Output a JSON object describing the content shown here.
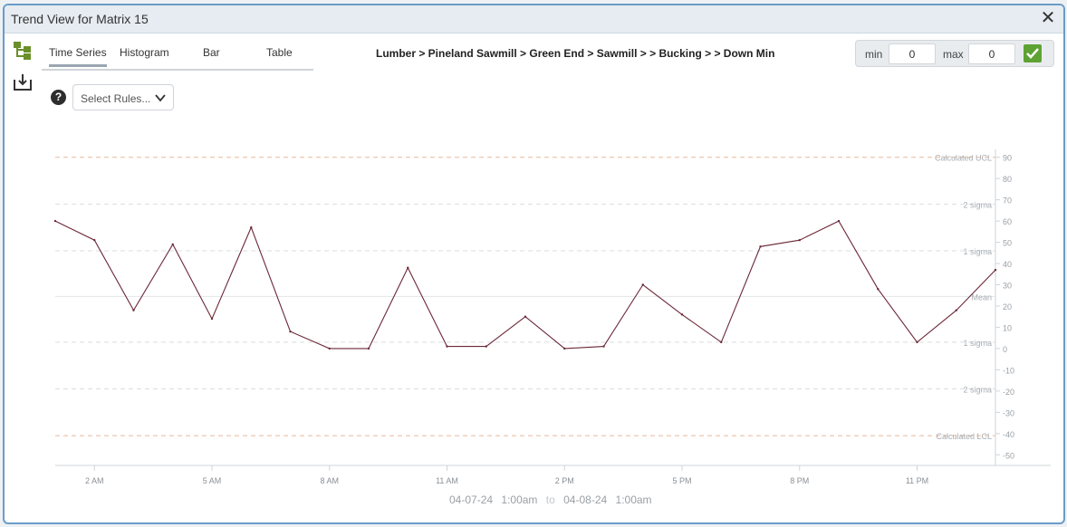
{
  "window": {
    "title": "Trend View for Matrix 15"
  },
  "tabs": [
    {
      "label": "Time Series",
      "active": true
    },
    {
      "label": "Histogram",
      "active": false
    },
    {
      "label": "Bar",
      "active": false
    },
    {
      "label": "Table",
      "active": false
    }
  ],
  "breadcrumb": "Lumber > Pineland Sawmill > Green End > Sawmill > > Bucking > > Down Min",
  "range": {
    "min_label": "min",
    "min_value": "0",
    "max_label": "max",
    "max_value": "0"
  },
  "rules": {
    "placeholder": "Select Rules..."
  },
  "help_label": "?",
  "date_range": {
    "start_date": "04-07-24",
    "start_time": "1:00am",
    "sep": "to",
    "end_date": "04-08-24",
    "end_time": "1:00am"
  },
  "icons": {
    "tree": "tree-structure-icon",
    "export": "download-icon",
    "apply": "check-icon",
    "close": "close-icon"
  },
  "colors": {
    "line": "#6b2737",
    "limit": "#e8b89a",
    "sigma": "#d9dde2",
    "apply": "#5fa234"
  },
  "chart_data": {
    "type": "line",
    "x": [
      "01:00",
      "02:00",
      "03:00",
      "04:00",
      "05:00",
      "06:00",
      "07:00",
      "08:00",
      "09:00",
      "10:00",
      "11:00",
      "12:00",
      "13:00",
      "14:00",
      "15:00",
      "16:00",
      "17:00",
      "18:00",
      "19:00",
      "20:00",
      "21:00",
      "22:00",
      "23:00",
      "00:00",
      "01:00"
    ],
    "series": [
      {
        "values": [
          60,
          51,
          18,
          49,
          14,
          57,
          8,
          0,
          0,
          38,
          1,
          1,
          15,
          0,
          1,
          30,
          16,
          3,
          48,
          51,
          60,
          28,
          3,
          18,
          37
        ]
      }
    ],
    "x_ticks": [
      "2 AM",
      "5 AM",
      "8 AM",
      "11 AM",
      "2 PM",
      "5 PM",
      "8 PM",
      "11 PM"
    ],
    "x_tick_hours": [
      1,
      4,
      7,
      10,
      13,
      16,
      19,
      22
    ],
    "y_ticks": [
      90,
      80,
      70,
      60,
      50,
      40,
      30,
      20,
      10,
      0,
      -10,
      -20,
      -30,
      -40,
      -50
    ],
    "ylim": [
      -55,
      92
    ],
    "reference_lines": [
      {
        "label": "Calculated UCL",
        "value": 90,
        "style": "limit"
      },
      {
        "label": "2 sigma",
        "value": 68,
        "style": "sigma"
      },
      {
        "label": "1 sigma",
        "value": 46,
        "style": "sigma"
      },
      {
        "label": "Mean",
        "value": 24.5,
        "style": "mean"
      },
      {
        "label": "1 sigma",
        "value": 3,
        "style": "sigma"
      },
      {
        "label": "2 sigma",
        "value": -19,
        "style": "sigma"
      },
      {
        "label": "Calculated LCL",
        "value": -41,
        "style": "limit"
      }
    ],
    "grid": false
  }
}
